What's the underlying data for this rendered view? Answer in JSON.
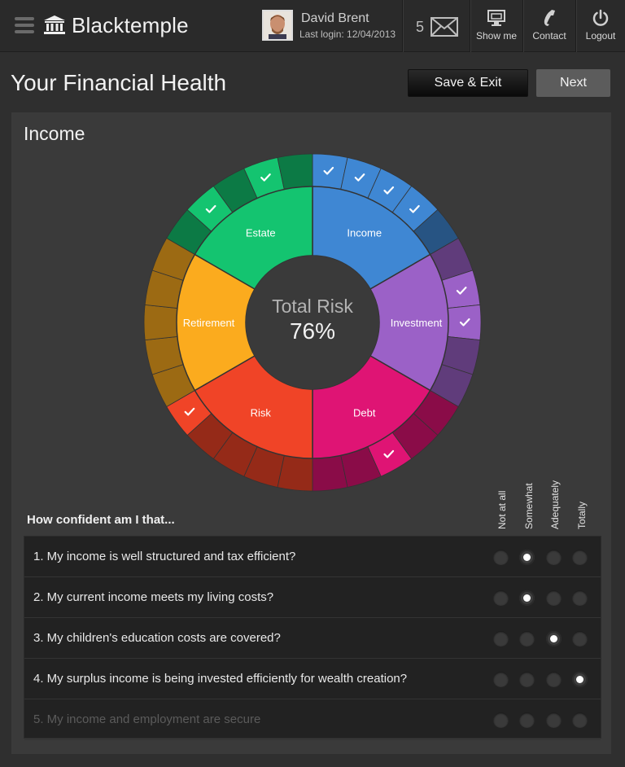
{
  "header": {
    "brand": "Blacktemple",
    "user_name": "David Brent",
    "last_login": "Last login: 12/04/2013",
    "message_count": "5",
    "buttons": [
      {
        "label": "Show me",
        "icon": "monitor-icon"
      },
      {
        "label": "Contact",
        "icon": "phone-icon"
      },
      {
        "label": "Logout",
        "icon": "power-icon"
      }
    ]
  },
  "page": {
    "title": "Your Financial Health",
    "save_exit": "Save & Exit",
    "next": "Next"
  },
  "panel": {
    "title": "Income"
  },
  "chart": {
    "center_label": "Total Risk",
    "center_value": "76%",
    "segments": [
      {
        "name": "Income",
        "color": "#3f87d3",
        "checks": [
          true,
          true,
          true,
          true,
          false
        ]
      },
      {
        "name": "Investment",
        "color": "#9b61c7",
        "checks": [
          false,
          true,
          true,
          false,
          false
        ]
      },
      {
        "name": "Debt",
        "color": "#df1474",
        "checks": [
          false,
          false,
          true,
          false,
          false
        ]
      },
      {
        "name": "Risk",
        "color": "#f04427",
        "checks": [
          false,
          false,
          false,
          false,
          true
        ]
      },
      {
        "name": "Retirement",
        "color": "#fbab1e",
        "checks": [
          false,
          false,
          false,
          false,
          false
        ]
      },
      {
        "name": "Estate",
        "color": "#14c470",
        "checks": [
          false,
          true,
          false,
          true,
          false
        ]
      }
    ]
  },
  "questions": {
    "heading": "How confident am I that...",
    "options": [
      "Not at all",
      "Somewhat",
      "Adequately",
      "Totally"
    ],
    "items": [
      {
        "text": "1. My income is well structured and tax efficient?",
        "selected": 1,
        "dimmed": false
      },
      {
        "text": "2. My current income meets my living costs?",
        "selected": 1,
        "dimmed": false
      },
      {
        "text": "3. My children's education costs are covered?",
        "selected": 2,
        "dimmed": false
      },
      {
        "text": "4. My surplus income is being invested efficiently for wealth creation?",
        "selected": 3,
        "dimmed": false
      },
      {
        "text": "5. My income and employment are secure",
        "selected": -1,
        "dimmed": true
      }
    ]
  }
}
